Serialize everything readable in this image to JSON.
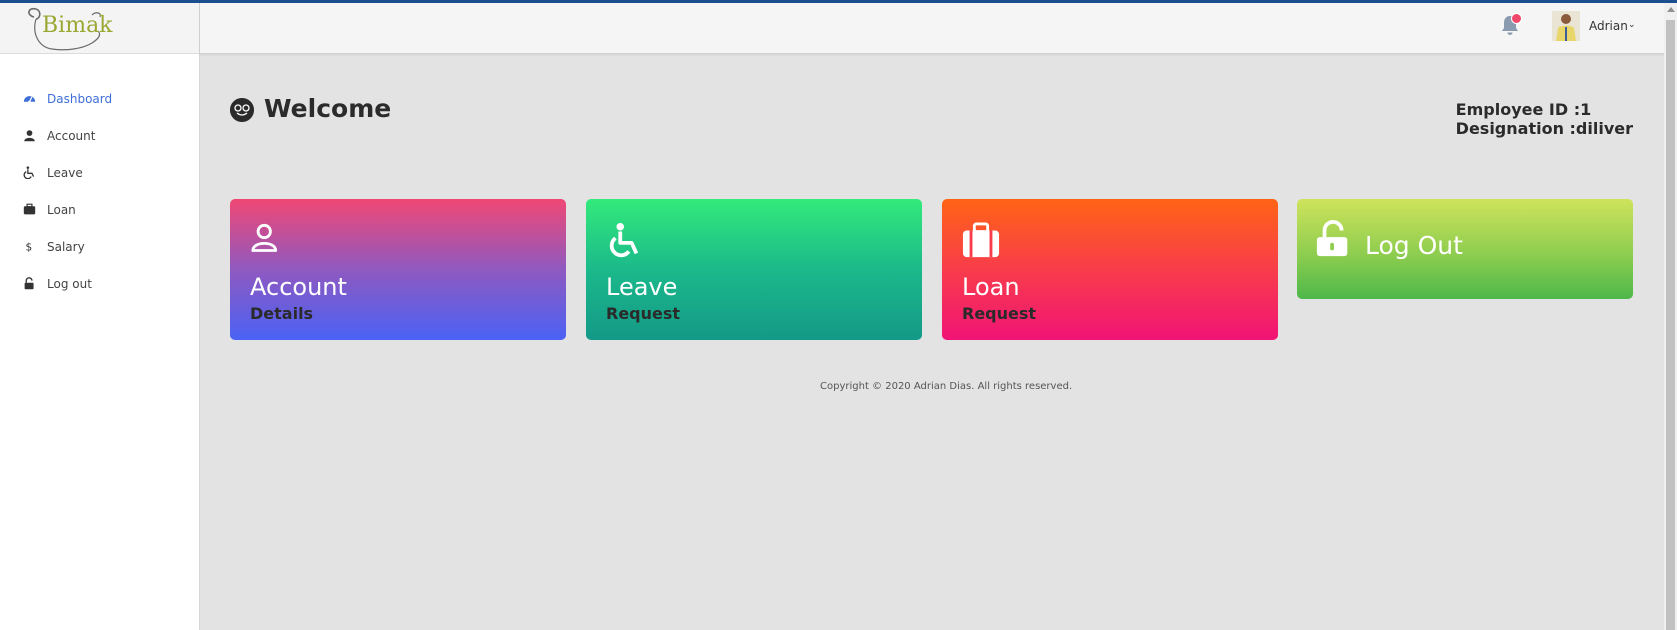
{
  "brand": {
    "logo_text": "Bimak"
  },
  "sidebar": {
    "items": [
      {
        "label": "Dashboard",
        "icon": "dashboard-icon",
        "active": true
      },
      {
        "label": "Account",
        "icon": "user-icon"
      },
      {
        "label": "Leave",
        "icon": "wheelchair-icon"
      },
      {
        "label": "Loan",
        "icon": "briefcase-icon"
      },
      {
        "label": "Salary",
        "icon": "dollar-icon"
      },
      {
        "label": "Log out",
        "icon": "unlock-icon"
      }
    ]
  },
  "header": {
    "notification_icon": "bell-icon",
    "user_name": "Adrian",
    "user_menu_icon": "chevron-down-icon"
  },
  "main": {
    "welcome": "Welcome",
    "employee_id": "Employee ID :1",
    "designation": "Designation :diliver",
    "cards": {
      "account": {
        "title": "Account",
        "subtitle": "Details",
        "icon": "user-icon"
      },
      "leave": {
        "title": "Leave",
        "subtitle": "Request",
        "icon": "wheelchair-icon"
      },
      "loan": {
        "title": "Loan",
        "subtitle": "Request",
        "icon": "briefcase-icon"
      },
      "logout": {
        "title": "Log Out",
        "icon": "unlock-icon"
      }
    },
    "copyright": "Copyright © 2020 Adrian Dias. All rights reserved."
  },
  "colors": {
    "accent": "#3f6fd8",
    "topline": "#1b4f8f",
    "account_gradient": [
      "#f04874",
      "#4a62f5"
    ],
    "leave_gradient": [
      "#33ea7b",
      "#149988"
    ],
    "loan_gradient": [
      "#ff6416",
      "#f11476"
    ],
    "logout_gradient": [
      "#cfe35c",
      "#4eb84a"
    ]
  }
}
